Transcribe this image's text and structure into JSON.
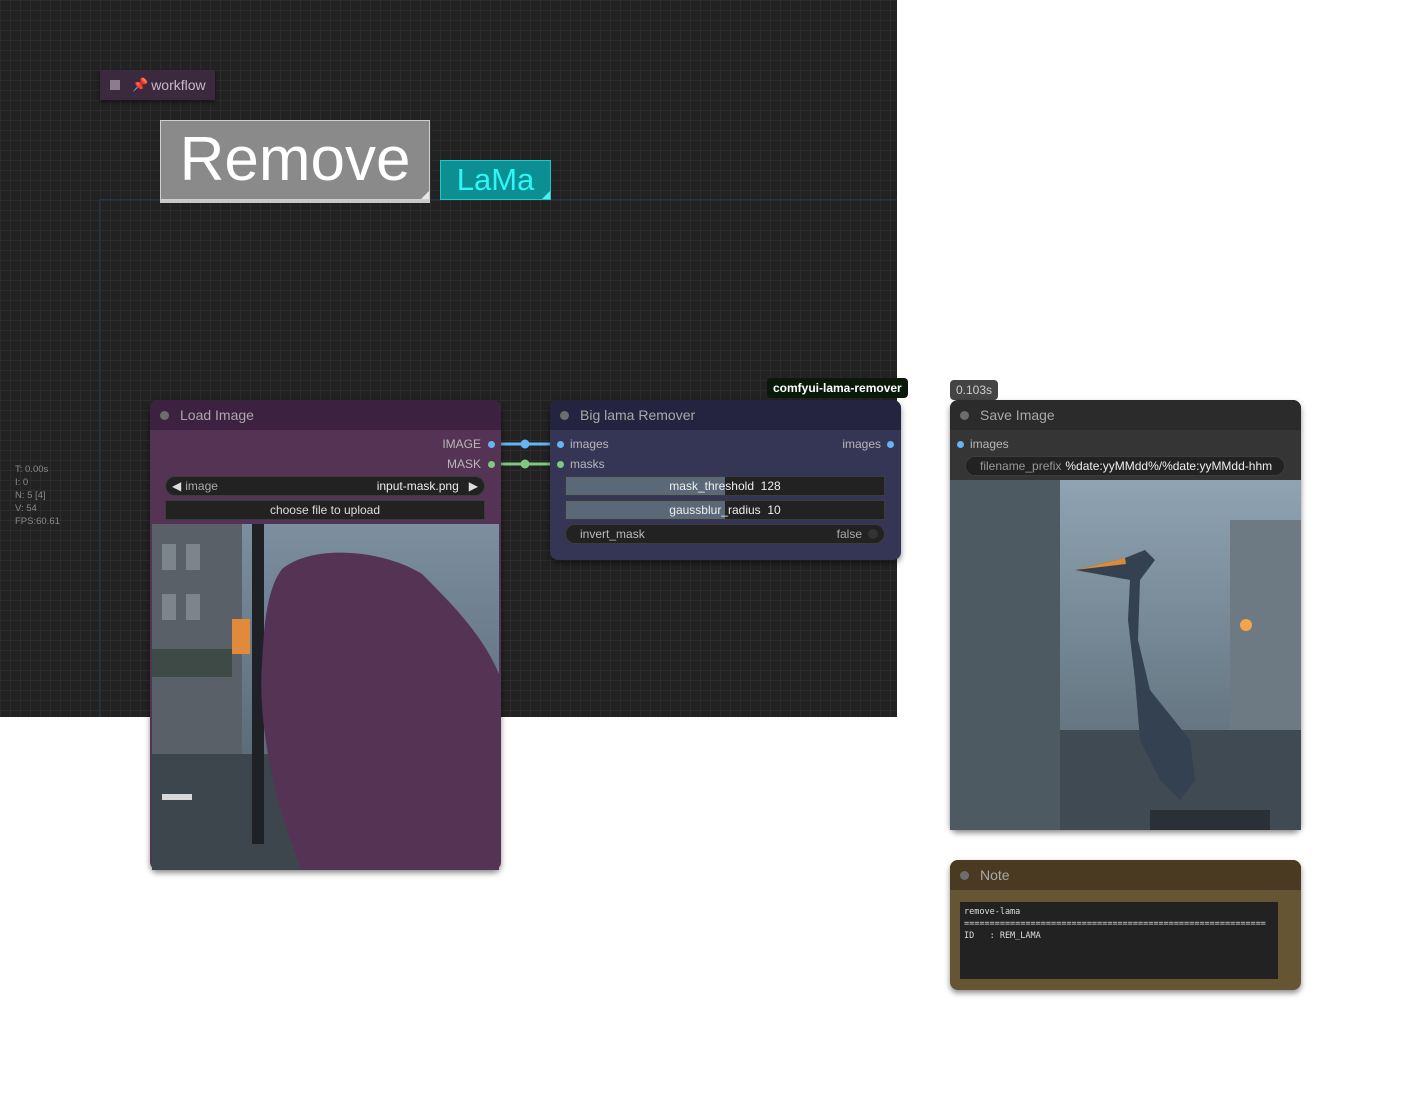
{
  "workflow_tag": {
    "label": "workflow",
    "pin_icon": "📌"
  },
  "stats": {
    "time": "T: 0.00s",
    "iter": "I: 0",
    "nodes": "N: 5 [4]",
    "vertices": "V: 54",
    "fps": "FPS:60.61"
  },
  "remove_text": "Remove",
  "lama_text": "LaMa",
  "tooltips": {
    "package": "comfyui-lama-remover",
    "exec_time": "0.103s"
  },
  "load_image": {
    "title": "Load Image",
    "outputs": [
      "IMAGE",
      "MASK"
    ],
    "image_widget": {
      "label": "image",
      "value": "input-mask.png",
      "prev_icon": "◀",
      "next_icon": "▶"
    },
    "upload_button": "choose file to upload"
  },
  "lama_remover": {
    "title": "Big lama Remover",
    "inputs": [
      "images",
      "masks"
    ],
    "outputs": [
      "images"
    ],
    "mask_threshold": {
      "label": "mask_threshold",
      "value": "128",
      "fraction": 0.5
    },
    "gaussblur_radius": {
      "label": "gaussblur_radius",
      "value": "10",
      "fraction": 0.5
    },
    "invert_mask": {
      "label": "invert_mask",
      "value": "false"
    }
  },
  "save_image": {
    "title": "Save Image",
    "inputs": [
      "images"
    ],
    "filename_prefix": {
      "label": "filename_prefix",
      "value": "%date:yyMMdd%/%date:yyMMdd-hhm"
    }
  },
  "note": {
    "title": "Note",
    "line1": "remove-lama",
    "line2": "===========================================================",
    "line3": "ID   : REM_LAMA"
  },
  "colors": {
    "canvas_bg": "#222222",
    "load_image_body": "#553355",
    "lama_body": "#335",
    "note_body": "#665533",
    "image_link": "#64b5f6",
    "mask_link": "#81c784"
  }
}
